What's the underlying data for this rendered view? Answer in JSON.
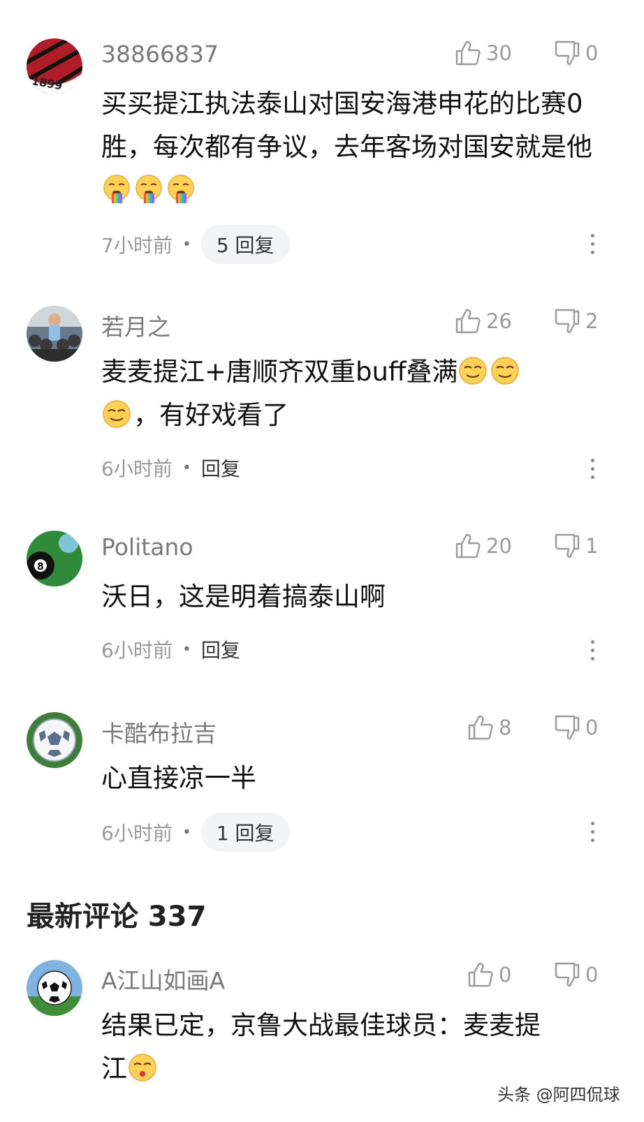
{
  "comments": [
    {
      "username": "38866837",
      "avatar_text": "1899",
      "likes": "30",
      "dislikes": "0",
      "text": "买买提江执法泰山对国安海港申花的比赛0胜，每次都有争议，去年客场对国安就是他",
      "emoji": "vomit-rainbow-emoji",
      "time": "7小时前",
      "reply": "5 回复"
    },
    {
      "username": "若月之",
      "likes": "26",
      "dislikes": "2",
      "text_line1": "麦麦提江+唐顺齐双重buff叠满",
      "text_line2": "，有好戏看了",
      "emoji": "smirk-emoji",
      "time": "6小时前",
      "reply": "回复"
    },
    {
      "username": "Politano",
      "likes": "20",
      "dislikes": "1",
      "text": "沃日，这是明着搞泰山啊",
      "time": "6小时前",
      "reply": "回复"
    },
    {
      "username": "卡酷布拉吉",
      "likes": "8",
      "dislikes": "0",
      "text": "心直接凉一半",
      "time": "6小时前",
      "reply": "1 回复"
    }
  ],
  "latest": {
    "title": "最新评论 337"
  },
  "latest_comment": {
    "username": "A江山如画A",
    "likes": "0",
    "dislikes": "0",
    "text_line1": "结果已定，京鲁大战最佳球员：麦麦提",
    "text_line2": "江",
    "emoji": "kiss-emoji"
  },
  "watermark": "头条 @阿四侃球",
  "colors": {
    "meta": "#999999",
    "username": "#7a7a7a",
    "pill_bg": "#f3f4f6"
  }
}
